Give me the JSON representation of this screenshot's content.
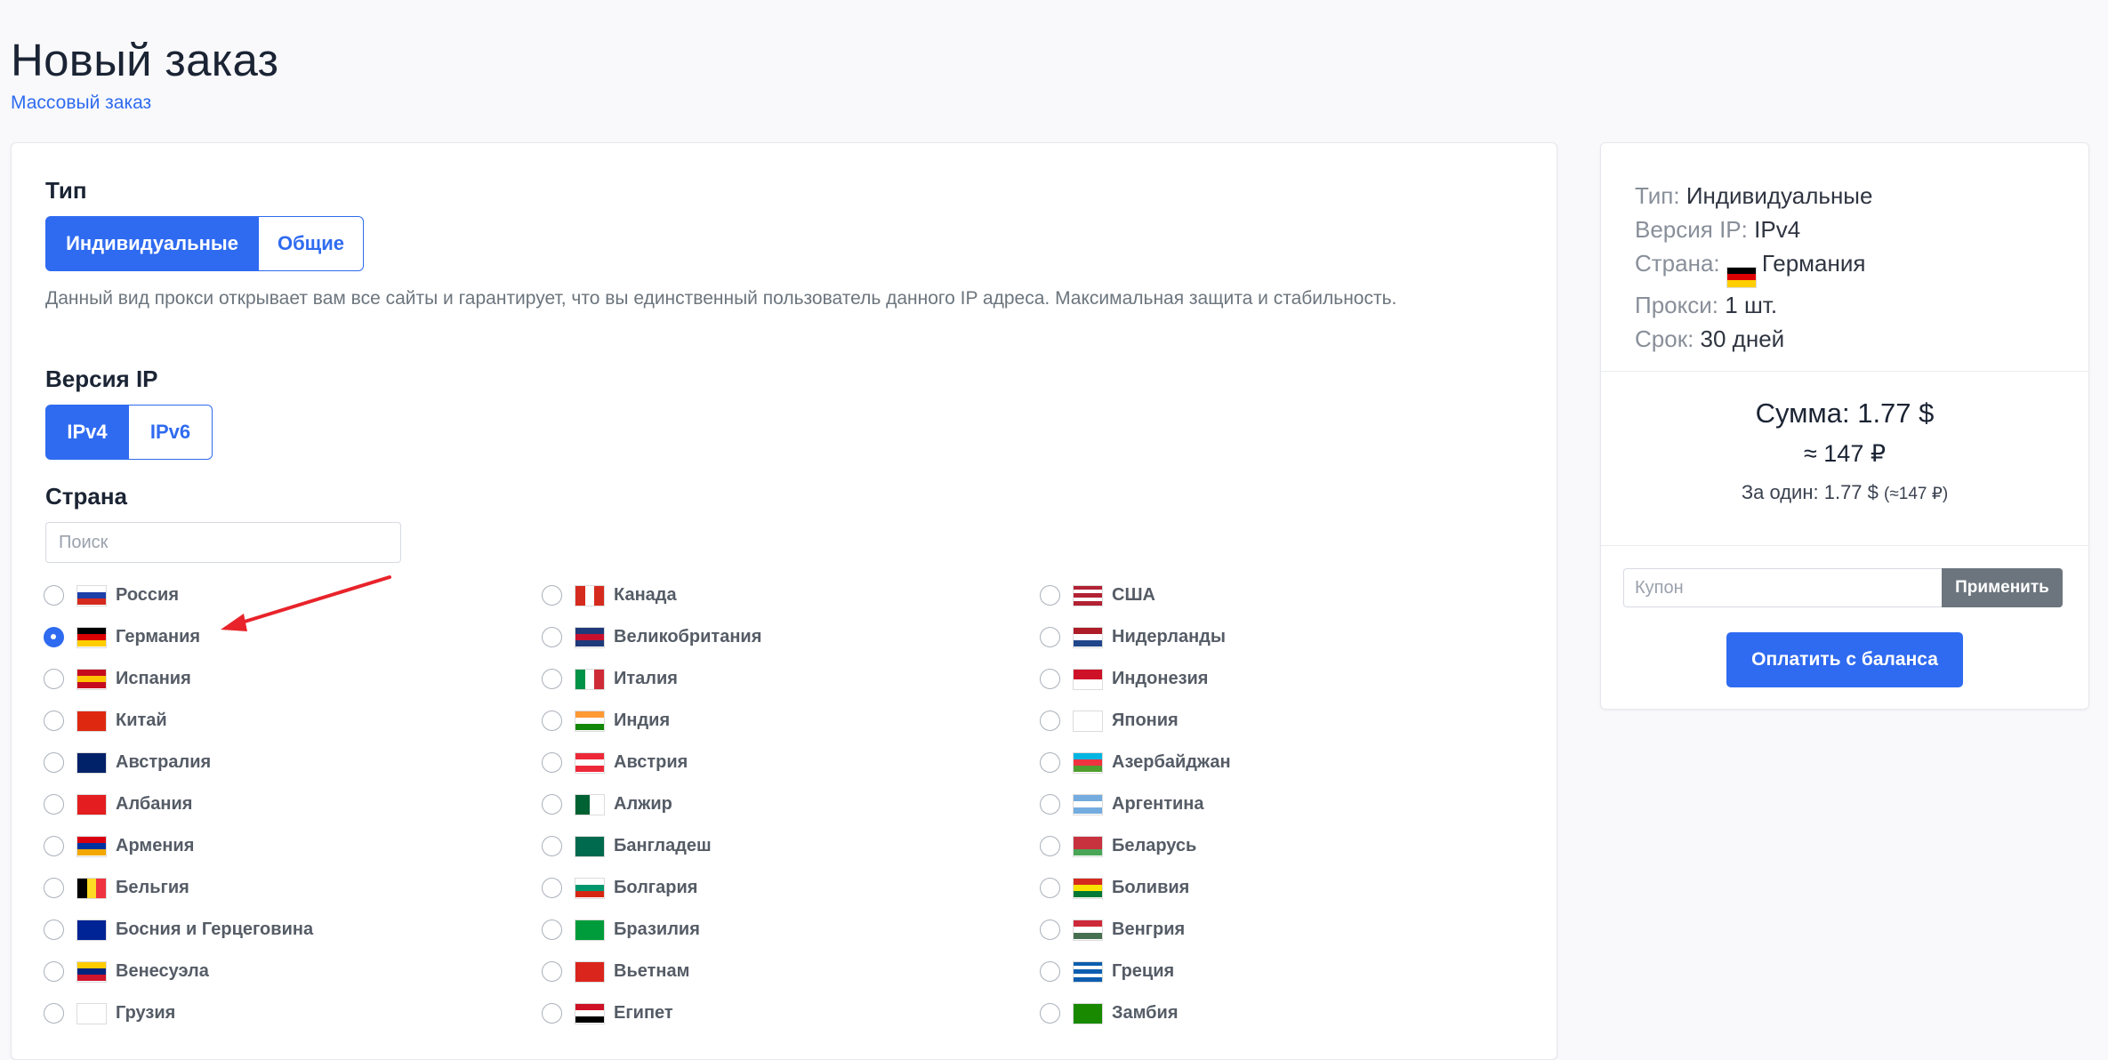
{
  "page": {
    "title": "Новый заказ",
    "bulk_order_link": "Массовый заказ"
  },
  "type_section": {
    "label": "Тип",
    "options": [
      "Индивидуальные",
      "Общие"
    ],
    "selected": "Индивидуальные",
    "description": "Данный вид прокси открывает вам все сайты и гарантирует, что вы единственный пользователь данного IP адреса. Максимальная защита и стабильность."
  },
  "ip_section": {
    "label": "Версия IP",
    "options": [
      "IPv4",
      "IPv6"
    ],
    "selected": "IPv4"
  },
  "country_section": {
    "label": "Страна",
    "search_placeholder": "Поиск",
    "selected": "Германия",
    "countries": [
      [
        {
          "name": "Россия",
          "flag": [
            "#ffffff",
            "#1c3fa8",
            "#d52b1e"
          ]
        },
        {
          "name": "Канада",
          "flag_h": [
            "#d52b1e",
            "#ffffff",
            "#d52b1e"
          ]
        },
        {
          "name": "США",
          "flag": [
            "#b22234",
            "#ffffff",
            "#b22234",
            "#ffffff",
            "#b22234"
          ]
        }
      ],
      [
        {
          "name": "Германия",
          "flag": [
            "#000000",
            "#dd0000",
            "#ffce00"
          ]
        },
        {
          "name": "Великобритания",
          "flag": [
            "#1f3a7a",
            "#c8102e",
            "#1f3a7a"
          ]
        },
        {
          "name": "Нидерланды",
          "flag": [
            "#ae1c28",
            "#ffffff",
            "#21468b"
          ]
        }
      ],
      [
        {
          "name": "Испания",
          "flag": [
            "#c60b1e",
            "#ffc400",
            "#c60b1e"
          ]
        },
        {
          "name": "Италия",
          "flag_h": [
            "#009246",
            "#ffffff",
            "#ce2b37"
          ]
        },
        {
          "name": "Индонезия",
          "flag": [
            "#ce1126",
            "#ffffff"
          ]
        }
      ],
      [
        {
          "name": "Китай",
          "flag": [
            "#de2910"
          ]
        },
        {
          "name": "Индия",
          "flag": [
            "#ff9933",
            "#ffffff",
            "#138808"
          ]
        },
        {
          "name": "Япония",
          "flag": [
            "#ffffff"
          ]
        }
      ],
      [
        {
          "name": "Австралия",
          "flag": [
            "#012169"
          ]
        },
        {
          "name": "Австрия",
          "flag": [
            "#ed2939",
            "#ffffff",
            "#ed2939"
          ]
        },
        {
          "name": "Азербайджан",
          "flag": [
            "#00b5e2",
            "#ef3340",
            "#509e2f"
          ]
        }
      ],
      [
        {
          "name": "Албания",
          "flag": [
            "#e41e20"
          ]
        },
        {
          "name": "Алжир",
          "flag_h": [
            "#006233",
            "#ffffff"
          ]
        },
        {
          "name": "Аргентина",
          "flag": [
            "#74acdf",
            "#ffffff",
            "#74acdf"
          ]
        }
      ],
      [
        {
          "name": "Армения",
          "flag": [
            "#d90012",
            "#0033a0",
            "#f2a800"
          ]
        },
        {
          "name": "Бангладеш",
          "flag": [
            "#006a4e"
          ]
        },
        {
          "name": "Беларусь",
          "flag": [
            "#c8313e",
            "#c8313e",
            "#4aa657"
          ]
        }
      ],
      [
        {
          "name": "Бельгия",
          "flag_h": [
            "#000000",
            "#fdda24",
            "#ef3340"
          ]
        },
        {
          "name": "Болгария",
          "flag": [
            "#ffffff",
            "#00966e",
            "#d62612"
          ]
        },
        {
          "name": "Боливия",
          "flag": [
            "#d52b1e",
            "#f9e300",
            "#007934"
          ]
        }
      ],
      [
        {
          "name": "Босния и Герцеговина",
          "flag": [
            "#002395"
          ]
        },
        {
          "name": "Бразилия",
          "flag": [
            "#009c3b"
          ]
        },
        {
          "name": "Венгрия",
          "flag": [
            "#ce2939",
            "#ffffff",
            "#477050"
          ]
        }
      ],
      [
        {
          "name": "Венесуэла",
          "flag": [
            "#ffcc00",
            "#00247d",
            "#cf142b"
          ]
        },
        {
          "name": "Вьетнам",
          "flag": [
            "#da251d"
          ]
        },
        {
          "name": "Греция",
          "flag": [
            "#0d5eaf",
            "#ffffff",
            "#0d5eaf",
            "#ffffff",
            "#0d5eaf"
          ]
        }
      ],
      [
        {
          "name": "Грузия",
          "flag": [
            "#ffffff"
          ]
        },
        {
          "name": "Египет",
          "flag": [
            "#ce1126",
            "#ffffff",
            "#000000"
          ]
        },
        {
          "name": "Замбия",
          "flag": [
            "#198a00"
          ]
        }
      ]
    ]
  },
  "summary": {
    "lines": [
      {
        "label": "Тип:",
        "value": "Индивидуальные"
      },
      {
        "label": "Версия IP:",
        "value": "IPv4"
      },
      {
        "label": "Страна:",
        "value": "Германия",
        "flag": [
          "#000000",
          "#dd0000",
          "#ffce00"
        ]
      },
      {
        "label": "Прокси:",
        "value": "1 шт."
      },
      {
        "label": "Срок:",
        "value": "30 дней"
      }
    ],
    "total": "Сумма: 1.77 $",
    "total_rub": "≈ 147 ₽",
    "per_one": "За один: 1.77 $",
    "per_one_rub": "(≈147 ₽)",
    "coupon_placeholder": "Купон",
    "apply_label": "Применить",
    "pay_label": "Оплатить с баланса"
  },
  "colors": {
    "accent": "#2f6bf0",
    "annotation_arrow": "#e8232a"
  }
}
